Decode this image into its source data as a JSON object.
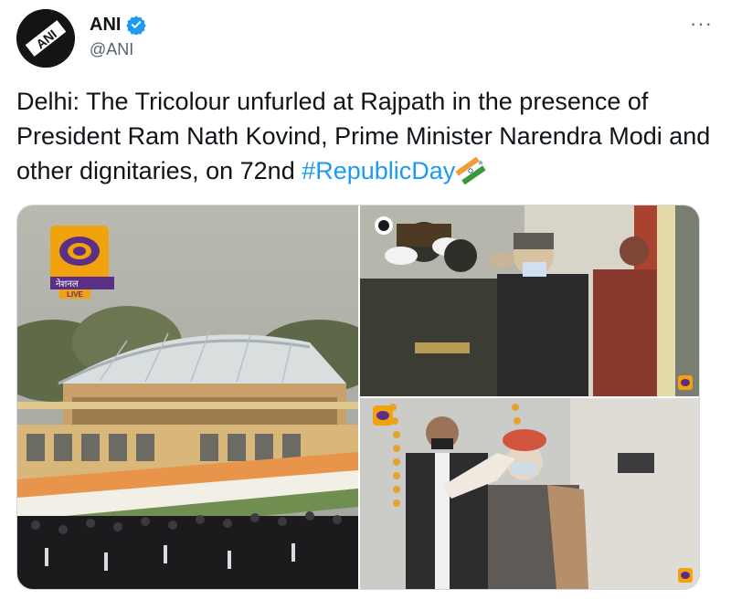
{
  "tweet": {
    "author": {
      "display_name": "ANI",
      "handle": "@ANI",
      "verified": true,
      "avatar_icon": "ani-logo-icon",
      "avatar_text": "ANI"
    },
    "more_label": "···",
    "text_before_hashtag": "Delhi: The Tricolour unfurled at Rajpath in the presence of President Ram Nath Kovind, Prime Minister Narendra Modi and other dignitaries, on 72nd ",
    "hashtag": "#RepublicDay",
    "hashtag_emoji": "tricolour-flag-emoji"
  },
  "media": {
    "images": [
      {
        "name": "rajpath-stands",
        "logo": {
          "channel": "DD",
          "label": "नेशनल",
          "badge": "LIVE"
        }
      },
      {
        "name": "officials-saluting"
      },
      {
        "name": "modi-saluting"
      }
    ]
  },
  "colors": {
    "text": "#0f1419",
    "secondary": "#536471",
    "link": "#1d9bf0",
    "border": "#cfd9de"
  }
}
